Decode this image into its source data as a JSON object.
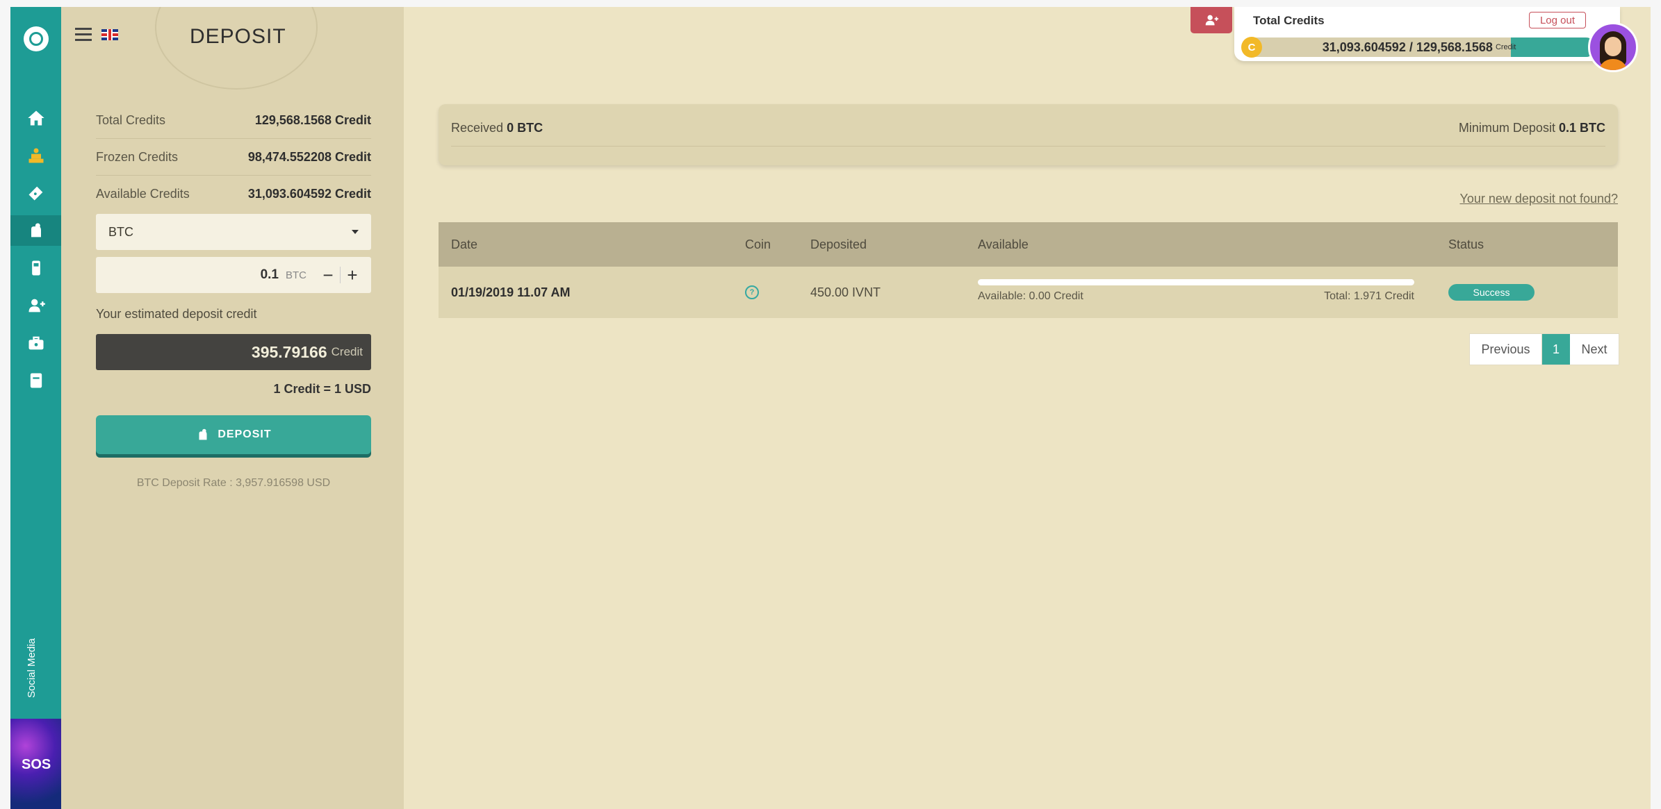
{
  "app": {
    "page_title": "DEPOSIT",
    "social_label": "Social Media",
    "sos_label": "SOS"
  },
  "nav": {
    "items": [
      {
        "name": "home-icon",
        "active": false
      },
      {
        "name": "bank-icon",
        "active": false
      },
      {
        "name": "ticket-icon",
        "active": false
      },
      {
        "name": "deposit-hand-icon",
        "active": true
      },
      {
        "name": "withdraw-icon",
        "active": false
      },
      {
        "name": "user-add-icon",
        "active": false
      },
      {
        "name": "briefcase-icon",
        "active": false
      },
      {
        "name": "book-icon",
        "active": false
      }
    ]
  },
  "summary": {
    "total_label": "Total Credits",
    "total_value": "129,568.1568 Credit",
    "frozen_label": "Frozen Credits",
    "frozen_value": "98,474.552208 Credit",
    "available_label": "Available Credits",
    "available_value": "31,093.604592 Credit"
  },
  "form": {
    "coin_selected": "BTC",
    "amount": "0.1",
    "amount_unit": "BTC",
    "minus": "−",
    "plus": "+",
    "estimate_label": "Your estimated deposit credit",
    "estimate_value": "395.79166",
    "estimate_unit": "Credit",
    "conversion": "1 Credit = 1 USD",
    "deposit_button": "DEPOSIT",
    "rate_note": "BTC Deposit Rate : 3,957.916598 USD"
  },
  "info": {
    "received_label": "Received",
    "received_value": "0 BTC",
    "minimum_label": "Minimum Deposit",
    "minimum_value": "0.1 BTC",
    "not_found_link": "Your new deposit not found?"
  },
  "table": {
    "headers": {
      "date": "Date",
      "coin": "Coin",
      "deposited": "Deposited",
      "available": "Available",
      "status": "Status"
    },
    "rows": [
      {
        "date": "01/19/2019 11.07 AM",
        "coin_icon": "coin-question-icon",
        "deposited": "450.00 IVNT",
        "available_text": "Available: 0.00 Credit",
        "total_text": "Total: 1.971 Credit",
        "available_fraction": 0,
        "status": "Success"
      }
    ]
  },
  "pagination": {
    "previous": "Previous",
    "current": "1",
    "next": "Next"
  },
  "widget": {
    "title": "Total Credits",
    "logout": "Log out",
    "coin_badge": "C",
    "value": "31,093.604592 / 129,568.1568",
    "unit": "Credit",
    "fill_fraction": 0.24
  },
  "colors": {
    "accent": "#38a898",
    "sidebar": "#1e9c95",
    "danger": "#c6505a",
    "background": "#ede4c4"
  }
}
